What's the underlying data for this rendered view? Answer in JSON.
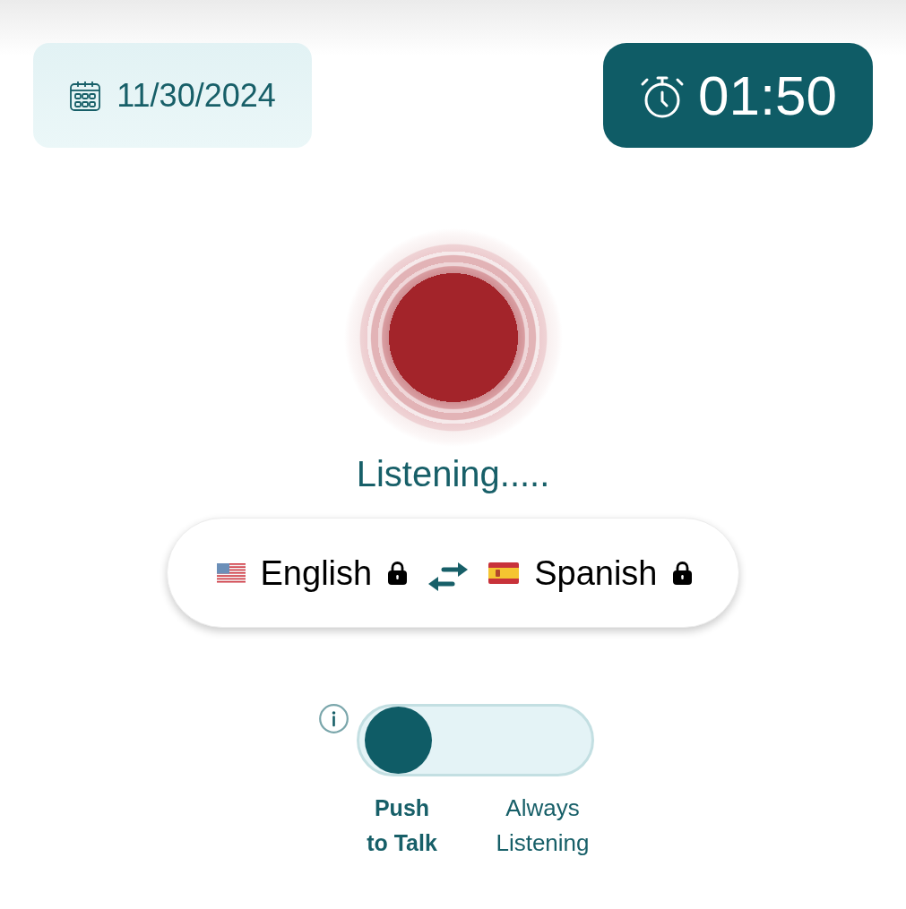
{
  "date_card": {
    "date": "11/30/2024"
  },
  "timer": {
    "time": "01:50"
  },
  "record_button": {
    "recording": true
  },
  "status": "Listening.....",
  "languages": {
    "source": {
      "name": "English",
      "locked": true
    },
    "target": {
      "name": "Spanish",
      "locked": true
    }
  },
  "mode_toggle": {
    "options": [
      {
        "label": "Push to Talk",
        "selected": true
      },
      {
        "label": "Always Listening",
        "selected": false
      }
    ]
  }
}
